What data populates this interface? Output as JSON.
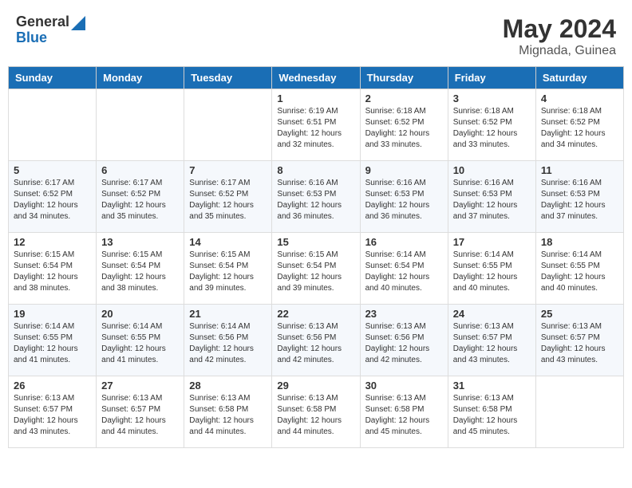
{
  "logo": {
    "general": "General",
    "blue": "Blue"
  },
  "title": {
    "month": "May 2024",
    "location": "Mignada, Guinea"
  },
  "header_days": [
    "Sunday",
    "Monday",
    "Tuesday",
    "Wednesday",
    "Thursday",
    "Friday",
    "Saturday"
  ],
  "weeks": [
    [
      {
        "day": "",
        "info": ""
      },
      {
        "day": "",
        "info": ""
      },
      {
        "day": "",
        "info": ""
      },
      {
        "day": "1",
        "info": "Sunrise: 6:19 AM\nSunset: 6:51 PM\nDaylight: 12 hours and 32 minutes."
      },
      {
        "day": "2",
        "info": "Sunrise: 6:18 AM\nSunset: 6:52 PM\nDaylight: 12 hours and 33 minutes."
      },
      {
        "day": "3",
        "info": "Sunrise: 6:18 AM\nSunset: 6:52 PM\nDaylight: 12 hours and 33 minutes."
      },
      {
        "day": "4",
        "info": "Sunrise: 6:18 AM\nSunset: 6:52 PM\nDaylight: 12 hours and 34 minutes."
      }
    ],
    [
      {
        "day": "5",
        "info": "Sunrise: 6:17 AM\nSunset: 6:52 PM\nDaylight: 12 hours and 34 minutes."
      },
      {
        "day": "6",
        "info": "Sunrise: 6:17 AM\nSunset: 6:52 PM\nDaylight: 12 hours and 35 minutes."
      },
      {
        "day": "7",
        "info": "Sunrise: 6:17 AM\nSunset: 6:52 PM\nDaylight: 12 hours and 35 minutes."
      },
      {
        "day": "8",
        "info": "Sunrise: 6:16 AM\nSunset: 6:53 PM\nDaylight: 12 hours and 36 minutes."
      },
      {
        "day": "9",
        "info": "Sunrise: 6:16 AM\nSunset: 6:53 PM\nDaylight: 12 hours and 36 minutes."
      },
      {
        "day": "10",
        "info": "Sunrise: 6:16 AM\nSunset: 6:53 PM\nDaylight: 12 hours and 37 minutes."
      },
      {
        "day": "11",
        "info": "Sunrise: 6:16 AM\nSunset: 6:53 PM\nDaylight: 12 hours and 37 minutes."
      }
    ],
    [
      {
        "day": "12",
        "info": "Sunrise: 6:15 AM\nSunset: 6:54 PM\nDaylight: 12 hours and 38 minutes."
      },
      {
        "day": "13",
        "info": "Sunrise: 6:15 AM\nSunset: 6:54 PM\nDaylight: 12 hours and 38 minutes."
      },
      {
        "day": "14",
        "info": "Sunrise: 6:15 AM\nSunset: 6:54 PM\nDaylight: 12 hours and 39 minutes."
      },
      {
        "day": "15",
        "info": "Sunrise: 6:15 AM\nSunset: 6:54 PM\nDaylight: 12 hours and 39 minutes."
      },
      {
        "day": "16",
        "info": "Sunrise: 6:14 AM\nSunset: 6:54 PM\nDaylight: 12 hours and 40 minutes."
      },
      {
        "day": "17",
        "info": "Sunrise: 6:14 AM\nSunset: 6:55 PM\nDaylight: 12 hours and 40 minutes."
      },
      {
        "day": "18",
        "info": "Sunrise: 6:14 AM\nSunset: 6:55 PM\nDaylight: 12 hours and 40 minutes."
      }
    ],
    [
      {
        "day": "19",
        "info": "Sunrise: 6:14 AM\nSunset: 6:55 PM\nDaylight: 12 hours and 41 minutes."
      },
      {
        "day": "20",
        "info": "Sunrise: 6:14 AM\nSunset: 6:55 PM\nDaylight: 12 hours and 41 minutes."
      },
      {
        "day": "21",
        "info": "Sunrise: 6:14 AM\nSunset: 6:56 PM\nDaylight: 12 hours and 42 minutes."
      },
      {
        "day": "22",
        "info": "Sunrise: 6:13 AM\nSunset: 6:56 PM\nDaylight: 12 hours and 42 minutes."
      },
      {
        "day": "23",
        "info": "Sunrise: 6:13 AM\nSunset: 6:56 PM\nDaylight: 12 hours and 42 minutes."
      },
      {
        "day": "24",
        "info": "Sunrise: 6:13 AM\nSunset: 6:57 PM\nDaylight: 12 hours and 43 minutes."
      },
      {
        "day": "25",
        "info": "Sunrise: 6:13 AM\nSunset: 6:57 PM\nDaylight: 12 hours and 43 minutes."
      }
    ],
    [
      {
        "day": "26",
        "info": "Sunrise: 6:13 AM\nSunset: 6:57 PM\nDaylight: 12 hours and 43 minutes."
      },
      {
        "day": "27",
        "info": "Sunrise: 6:13 AM\nSunset: 6:57 PM\nDaylight: 12 hours and 44 minutes."
      },
      {
        "day": "28",
        "info": "Sunrise: 6:13 AM\nSunset: 6:58 PM\nDaylight: 12 hours and 44 minutes."
      },
      {
        "day": "29",
        "info": "Sunrise: 6:13 AM\nSunset: 6:58 PM\nDaylight: 12 hours and 44 minutes."
      },
      {
        "day": "30",
        "info": "Sunrise: 6:13 AM\nSunset: 6:58 PM\nDaylight: 12 hours and 45 minutes."
      },
      {
        "day": "31",
        "info": "Sunrise: 6:13 AM\nSunset: 6:58 PM\nDaylight: 12 hours and 45 minutes."
      },
      {
        "day": "",
        "info": ""
      }
    ]
  ]
}
